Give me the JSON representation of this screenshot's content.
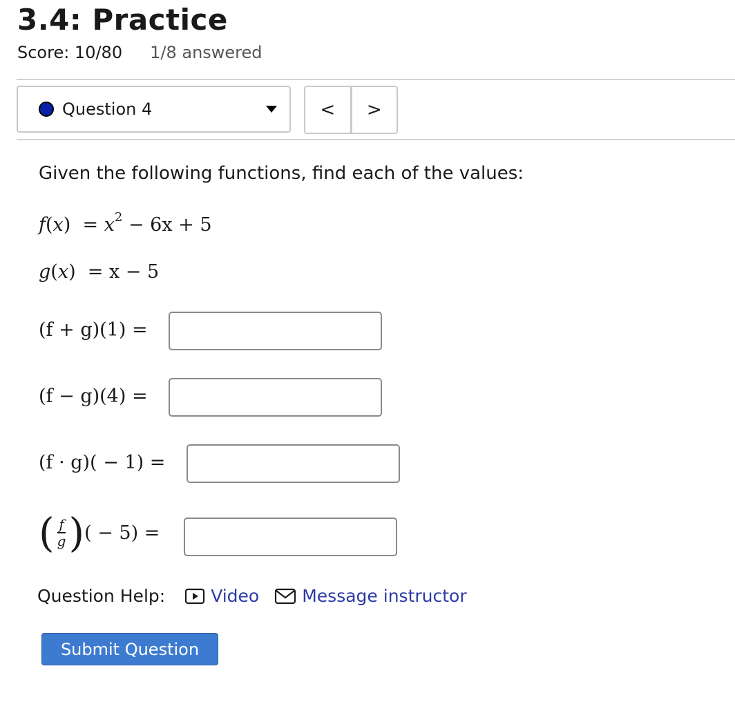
{
  "header": {
    "title": "3.4: Practice",
    "score": "Score: 10/80",
    "answered": "1/8 answered"
  },
  "question_nav": {
    "selected": "Question 4",
    "status_color": "#0a1fa8",
    "prev_label": "<",
    "next_label": ">"
  },
  "question": {
    "prompt": "Given the following functions, find each of the values:",
    "f_def": {
      "name": "f",
      "var": "x",
      "rhs_pre": "x",
      "exp": "2",
      "rhs_post": " − 6x + 5"
    },
    "g_def": {
      "name": "g",
      "var": "x",
      "rhs": "x − 5"
    },
    "parts": [
      {
        "expr": "(f + g)(1) =",
        "value": ""
      },
      {
        "expr": "(f − g)(4) =",
        "value": ""
      },
      {
        "expr": "(f · g)( − 1) =",
        "value": ""
      },
      {
        "frac_num": "f",
        "frac_den": "g",
        "expr_tail": "( − 5) =",
        "value": ""
      }
    ]
  },
  "help": {
    "label": "Question Help:",
    "video": "Video",
    "message": "Message instructor"
  },
  "submit_label": "Submit Question",
  "colors": {
    "link": "#2b3ba8",
    "submit_bg": "#3d7bd0"
  }
}
